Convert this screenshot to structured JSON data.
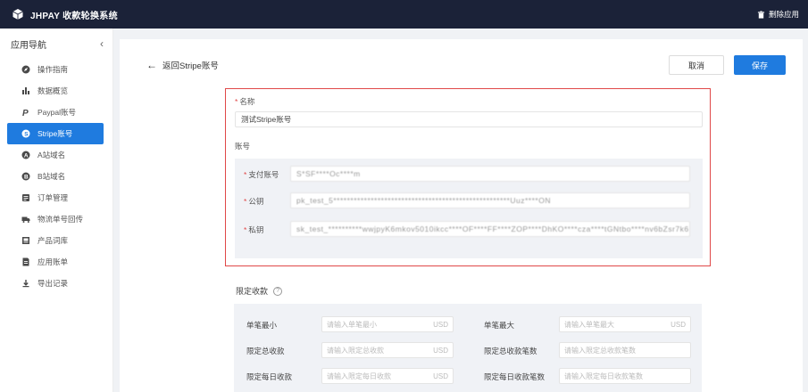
{
  "app": {
    "title": "JHPAY 收款轮换系统",
    "delete_label": "删除应用"
  },
  "sidebar": {
    "header": "应用导航",
    "collapse_glyph": "‹",
    "items": [
      {
        "label": "操作指南",
        "icon": "compass-icon"
      },
      {
        "label": "数据概览",
        "icon": "bar-chart-icon"
      },
      {
        "label": "Paypal账号",
        "icon": "paypal-icon"
      },
      {
        "label": "Stripe账号",
        "icon": "stripe-icon",
        "active": true
      },
      {
        "label": "A站域名",
        "icon": "a-circle-icon"
      },
      {
        "label": "B站域名",
        "icon": "b-circle-icon"
      },
      {
        "label": "订单管理",
        "icon": "list-icon"
      },
      {
        "label": "物流单号回传",
        "icon": "truck-icon"
      },
      {
        "label": "产品词库",
        "icon": "dictionary-icon"
      },
      {
        "label": "应用账单",
        "icon": "bill-icon"
      },
      {
        "label": "导出记录",
        "icon": "download-icon"
      }
    ]
  },
  "form": {
    "back_label": "返回Stripe账号",
    "cancel_label": "取消",
    "save_label": "保存",
    "name_label": "名称",
    "name_value": "测试Stripe账号",
    "account_section": "账号",
    "pay_account_label": "支付账号",
    "pay_account_value": "S*SF****Oc****m",
    "public_key_label": "公钥",
    "public_key_value": "pk_test_5****************************************************Uuz****ON",
    "private_key_label": "私钥",
    "private_key_value": "sk_test_**********wwjpyK6mkov5010ikcc****OF****FF****ZOP****DhKO****cza****tGNtbo****nv6bZsr7k6"
  },
  "limits": {
    "title": "限定收款",
    "help_glyph": "?",
    "currency": "USD",
    "rows": [
      {
        "left_label": "单笔最小",
        "left_placeholder": "请输入单笔最小",
        "left_currency": true,
        "right_label": "单笔最大",
        "right_placeholder": "请输入单笔最大",
        "right_currency": true
      },
      {
        "left_label": "限定总收款",
        "left_placeholder": "请输入限定总收款",
        "left_currency": true,
        "right_label": "限定总收款笔数",
        "right_placeholder": "请输入限定总收款笔数",
        "right_currency": false
      },
      {
        "left_label": "限定每日收款",
        "left_placeholder": "请输入限定每日收款",
        "left_currency": true,
        "right_label": "限定每日收款笔数",
        "right_placeholder": "请输入限定每日收款笔数",
        "right_currency": false
      }
    ]
  },
  "colors": {
    "topbar": "#1b2238",
    "accent": "#1f7bdf",
    "highlight_border": "#e04848"
  }
}
